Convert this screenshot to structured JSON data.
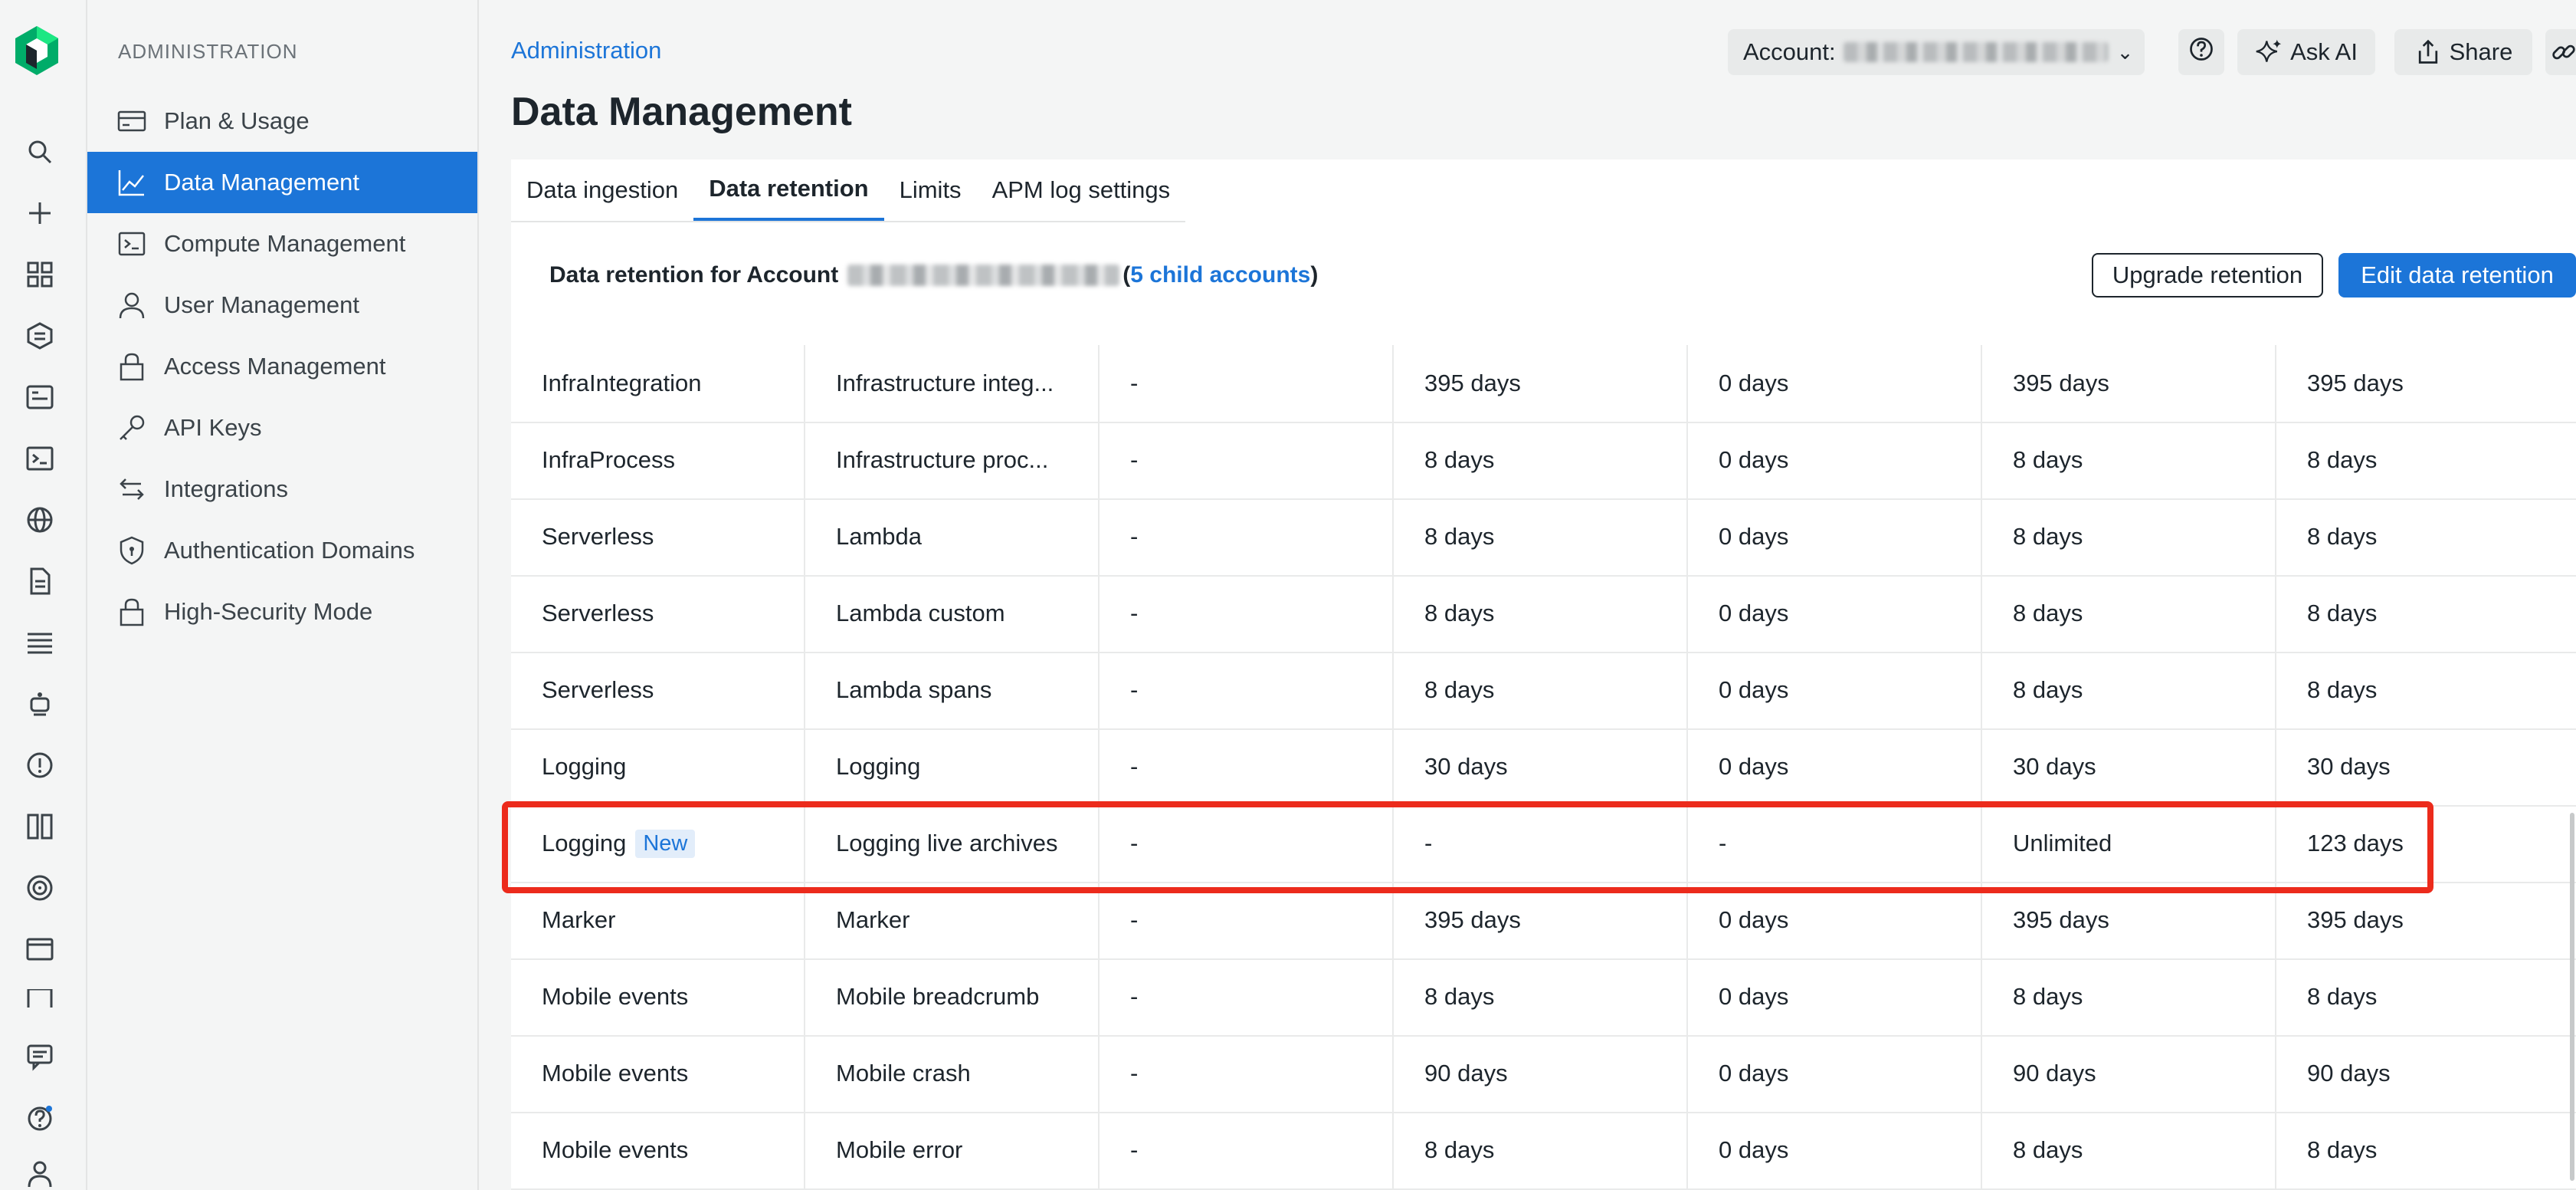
{
  "sidebar": {
    "heading": "ADMINISTRATION",
    "items": [
      {
        "label": "Plan & Usage",
        "icon": "card-icon"
      },
      {
        "label": "Data Management",
        "icon": "chart-icon",
        "active": true
      },
      {
        "label": "Compute Management",
        "icon": "terminal-icon"
      },
      {
        "label": "User Management",
        "icon": "user-icon"
      },
      {
        "label": "Access Management",
        "icon": "lock-icon"
      },
      {
        "label": "API Keys",
        "icon": "key-icon"
      },
      {
        "label": "Integrations",
        "icon": "arrows-icon"
      },
      {
        "label": "Authentication Domains",
        "icon": "shield-icon"
      },
      {
        "label": "High-Security Mode",
        "icon": "lock-icon"
      }
    ]
  },
  "header": {
    "breadcrumb": "Administration",
    "title": "Data Management",
    "account_label": "Account:",
    "ask_ai": "Ask AI",
    "share": "Share"
  },
  "tabs": [
    "Data ingestion",
    "Data retention",
    "Limits",
    "APM log settings"
  ],
  "retention": {
    "prefix": "Data retention for Account",
    "paren_open": "(",
    "child_link": "5 child accounts",
    "paren_close": ")",
    "upgrade_button": "Upgrade retention",
    "edit_button": "Edit data retention"
  },
  "table": {
    "rows": [
      [
        "InfraIntegration",
        "Infrastructure integ...",
        "-",
        "395 days",
        "0 days",
        "395 days",
        "395 days"
      ],
      [
        "InfraProcess",
        "Infrastructure proc...",
        "-",
        "8 days",
        "0 days",
        "8 days",
        "8 days"
      ],
      [
        "Serverless",
        "Lambda",
        "-",
        "8 days",
        "0 days",
        "8 days",
        "8 days"
      ],
      [
        "Serverless",
        "Lambda custom",
        "-",
        "8 days",
        "0 days",
        "8 days",
        "8 days"
      ],
      [
        "Serverless",
        "Lambda spans",
        "-",
        "8 days",
        "0 days",
        "8 days",
        "8 days"
      ],
      [
        "Logging",
        "Logging",
        "-",
        "30 days",
        "0 days",
        "30 days",
        "30 days"
      ],
      [
        "Logging",
        "Logging live archives",
        "-",
        "-",
        "-",
        "Unlimited",
        "123 days"
      ],
      [
        "Marker",
        "Marker",
        "-",
        "395 days",
        "0 days",
        "395 days",
        "395 days"
      ],
      [
        "Mobile events",
        "Mobile breadcrumb",
        "-",
        "8 days",
        "0 days",
        "8 days",
        "8 days"
      ],
      [
        "Mobile events",
        "Mobile crash",
        "-",
        "90 days",
        "0 days",
        "90 days",
        "90 days"
      ],
      [
        "Mobile events",
        "Mobile error",
        "-",
        "8 days",
        "0 days",
        "8 days",
        "8 days"
      ]
    ],
    "new_badge": "New",
    "new_badge_row": 6
  },
  "colors": {
    "accent": "#1c75d8",
    "highlight": "#ec2b1c",
    "logo": "#1ce783"
  }
}
